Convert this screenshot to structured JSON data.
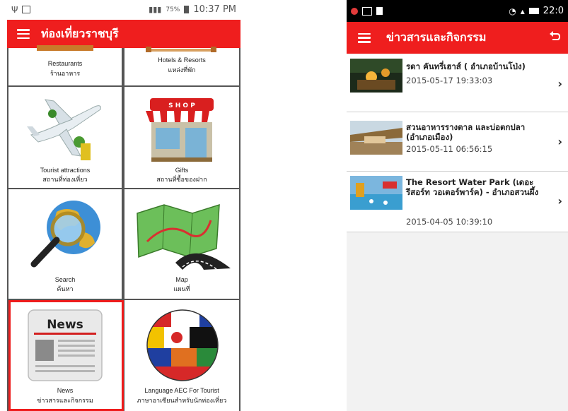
{
  "left_phone": {
    "status": {
      "time": "10:37 PM",
      "battery": "75%"
    },
    "title": "ท่องเที่ยวราชบุรี",
    "tiles": [
      {
        "en": "Restaurants",
        "th": "ร้านอาหาร"
      },
      {
        "en": "Hotels & Resorts",
        "th": "แหล่งที่พัก"
      },
      {
        "en": "Tourist attractions",
        "th": "สถานที่ท่องเที่ยว"
      },
      {
        "en": "Gifts",
        "th": "สถานที่ซื้อของฝาก"
      },
      {
        "en": "Search",
        "th": "ค้นหา"
      },
      {
        "en": "Map",
        "th": "แผนที่"
      },
      {
        "en": "News",
        "th": "ข่าวสารและกิจกรรม"
      },
      {
        "en": "Language AEC For Tourist",
        "th": "ภาษาอาเซียนสำหรับนักท่องเที่ยว"
      }
    ],
    "shop_sign": "S H O P",
    "news_icon_text": "News"
  },
  "right_phone": {
    "status": {
      "time": "22:0"
    },
    "title": "ข่าวสารและกิจกรรม",
    "items": [
      {
        "title": "รดา คันทรี่เฮาส์ ( อำเภอบ้านโป่ง)",
        "date": "2015-05-17 19:33:03"
      },
      {
        "title": "สวนอาหารรางตาล และบ่อตกปลา (อำเภอเมือง)",
        "date": "2015-05-11 06:56:15"
      },
      {
        "title": "The Resort Water Park (เดอะรีสอร์ท วอเตอร์พาร์ค) - อำเภอสวนผึ้ง",
        "date": "2015-04-05 10:39:10"
      }
    ]
  },
  "colors": {
    "accent": "#ef1e1e",
    "highlight": "#ee1c1c"
  }
}
